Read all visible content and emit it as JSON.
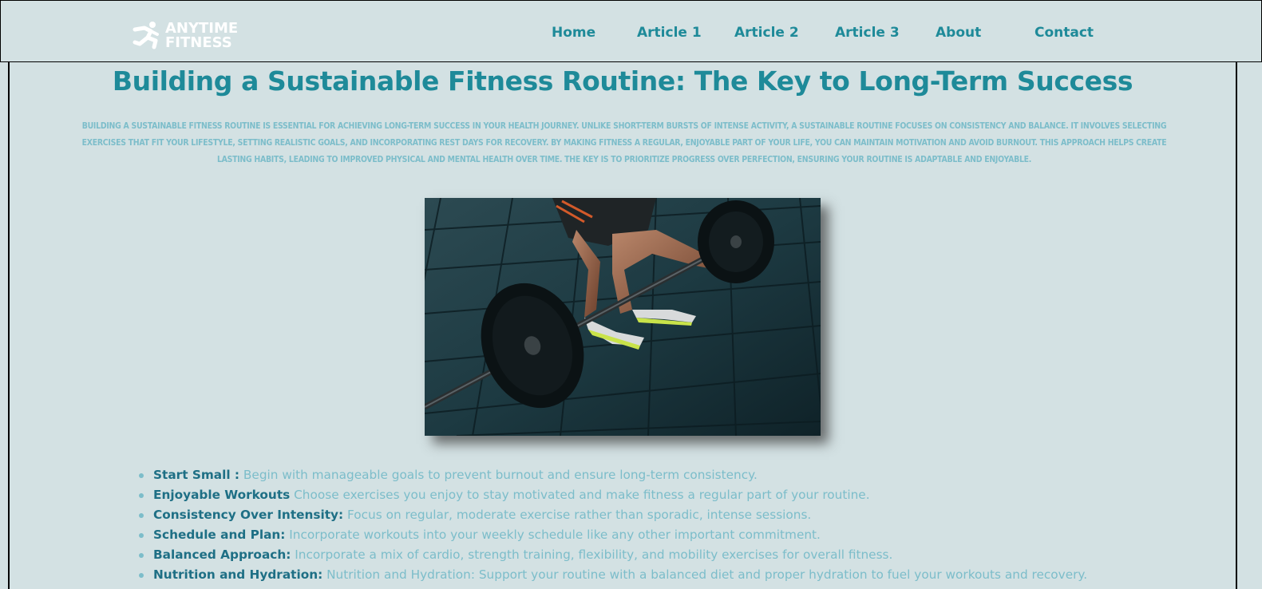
{
  "brand": {
    "line1": "ANYTIME",
    "line2": "FITNESS",
    "logo_icon": "running-man-icon"
  },
  "nav": {
    "items": [
      "Home",
      "Article 1",
      "Article 2",
      "Article 3",
      "About",
      "Contact"
    ]
  },
  "article": {
    "title": "Building a Sustainable Fitness Routine: The Key to Long-Term Success",
    "intro": "Building a sustainable fitness routine is essential for achieving long-term success in your health journey. Unlike short-term bursts of intense activity, a sustainable routine focuses on consistency and balance. It involves selecting exercises that fit your lifestyle, setting realistic goals, and incorporating rest days for recovery. By making fitness a regular, enjoyable part of your life, you can maintain motivation and avoid burnout. This approach helps create lasting habits, leading to improved physical and mental health over time. The key is to prioritize progress over perfection, ensuring your routine is adaptable and enjoyable.",
    "image": "barbell-deadlift-photo",
    "tips": [
      {
        "label": "Start Small :",
        "text": "Begin with manageable goals to prevent burnout and ensure long-term consistency."
      },
      {
        "label": "Enjoyable Workouts",
        "text": "Choose exercises you enjoy to stay motivated and make fitness a regular part of your routine."
      },
      {
        "label": "Consistency Over Intensity:",
        "text": "Focus on regular, moderate exercise rather than sporadic, intense sessions."
      },
      {
        "label": "Schedule and Plan:",
        "text": "Incorporate workouts into your weekly schedule like any other important commitment."
      },
      {
        "label": "Balanced Approach:",
        "text": "Incorporate a mix of cardio, strength training, flexibility, and mobility exercises for overall fitness."
      },
      {
        "label": "Nutrition and Hydration:",
        "text": "Nutrition and Hydration: Support your routine with a balanced diet and proper hydration to fuel your workouts and recovery."
      }
    ]
  },
  "colors": {
    "background": "#d3e1e3",
    "accent": "#1e8a99",
    "muted_text": "#7cbdca"
  }
}
